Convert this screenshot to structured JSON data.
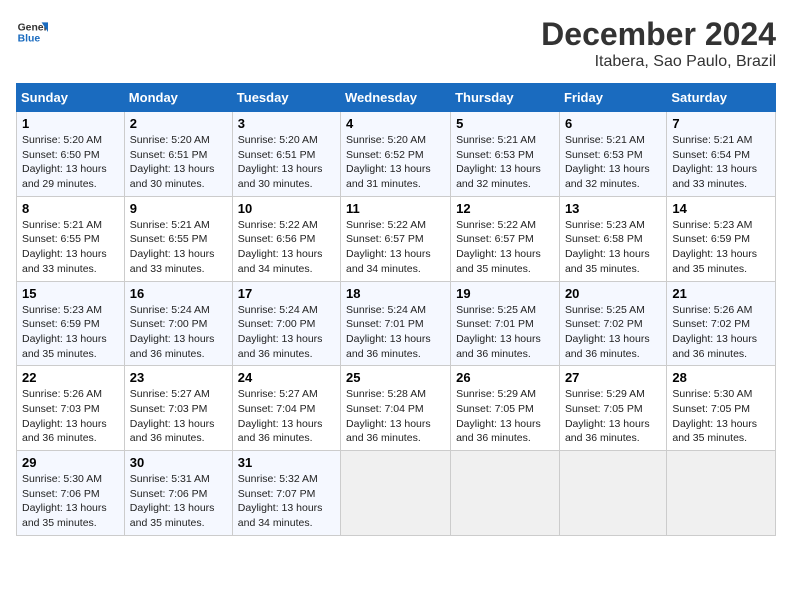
{
  "logo": {
    "text_general": "General",
    "text_blue": "Blue"
  },
  "title": "December 2024",
  "subtitle": "Itabera, Sao Paulo, Brazil",
  "days_of_week": [
    "Sunday",
    "Monday",
    "Tuesday",
    "Wednesday",
    "Thursday",
    "Friday",
    "Saturday"
  ],
  "weeks": [
    [
      {
        "day": "1",
        "info": "Sunrise: 5:20 AM\nSunset: 6:50 PM\nDaylight: 13 hours\nand 29 minutes."
      },
      {
        "day": "2",
        "info": "Sunrise: 5:20 AM\nSunset: 6:51 PM\nDaylight: 13 hours\nand 30 minutes."
      },
      {
        "day": "3",
        "info": "Sunrise: 5:20 AM\nSunset: 6:51 PM\nDaylight: 13 hours\nand 30 minutes."
      },
      {
        "day": "4",
        "info": "Sunrise: 5:20 AM\nSunset: 6:52 PM\nDaylight: 13 hours\nand 31 minutes."
      },
      {
        "day": "5",
        "info": "Sunrise: 5:21 AM\nSunset: 6:53 PM\nDaylight: 13 hours\nand 32 minutes."
      },
      {
        "day": "6",
        "info": "Sunrise: 5:21 AM\nSunset: 6:53 PM\nDaylight: 13 hours\nand 32 minutes."
      },
      {
        "day": "7",
        "info": "Sunrise: 5:21 AM\nSunset: 6:54 PM\nDaylight: 13 hours\nand 33 minutes."
      }
    ],
    [
      {
        "day": "8",
        "info": "Sunrise: 5:21 AM\nSunset: 6:55 PM\nDaylight: 13 hours\nand 33 minutes."
      },
      {
        "day": "9",
        "info": "Sunrise: 5:21 AM\nSunset: 6:55 PM\nDaylight: 13 hours\nand 33 minutes."
      },
      {
        "day": "10",
        "info": "Sunrise: 5:22 AM\nSunset: 6:56 PM\nDaylight: 13 hours\nand 34 minutes."
      },
      {
        "day": "11",
        "info": "Sunrise: 5:22 AM\nSunset: 6:57 PM\nDaylight: 13 hours\nand 34 minutes."
      },
      {
        "day": "12",
        "info": "Sunrise: 5:22 AM\nSunset: 6:57 PM\nDaylight: 13 hours\nand 35 minutes."
      },
      {
        "day": "13",
        "info": "Sunrise: 5:23 AM\nSunset: 6:58 PM\nDaylight: 13 hours\nand 35 minutes."
      },
      {
        "day": "14",
        "info": "Sunrise: 5:23 AM\nSunset: 6:59 PM\nDaylight: 13 hours\nand 35 minutes."
      }
    ],
    [
      {
        "day": "15",
        "info": "Sunrise: 5:23 AM\nSunset: 6:59 PM\nDaylight: 13 hours\nand 35 minutes."
      },
      {
        "day": "16",
        "info": "Sunrise: 5:24 AM\nSunset: 7:00 PM\nDaylight: 13 hours\nand 36 minutes."
      },
      {
        "day": "17",
        "info": "Sunrise: 5:24 AM\nSunset: 7:00 PM\nDaylight: 13 hours\nand 36 minutes."
      },
      {
        "day": "18",
        "info": "Sunrise: 5:24 AM\nSunset: 7:01 PM\nDaylight: 13 hours\nand 36 minutes."
      },
      {
        "day": "19",
        "info": "Sunrise: 5:25 AM\nSunset: 7:01 PM\nDaylight: 13 hours\nand 36 minutes."
      },
      {
        "day": "20",
        "info": "Sunrise: 5:25 AM\nSunset: 7:02 PM\nDaylight: 13 hours\nand 36 minutes."
      },
      {
        "day": "21",
        "info": "Sunrise: 5:26 AM\nSunset: 7:02 PM\nDaylight: 13 hours\nand 36 minutes."
      }
    ],
    [
      {
        "day": "22",
        "info": "Sunrise: 5:26 AM\nSunset: 7:03 PM\nDaylight: 13 hours\nand 36 minutes."
      },
      {
        "day": "23",
        "info": "Sunrise: 5:27 AM\nSunset: 7:03 PM\nDaylight: 13 hours\nand 36 minutes."
      },
      {
        "day": "24",
        "info": "Sunrise: 5:27 AM\nSunset: 7:04 PM\nDaylight: 13 hours\nand 36 minutes."
      },
      {
        "day": "25",
        "info": "Sunrise: 5:28 AM\nSunset: 7:04 PM\nDaylight: 13 hours\nand 36 minutes."
      },
      {
        "day": "26",
        "info": "Sunrise: 5:29 AM\nSunset: 7:05 PM\nDaylight: 13 hours\nand 36 minutes."
      },
      {
        "day": "27",
        "info": "Sunrise: 5:29 AM\nSunset: 7:05 PM\nDaylight: 13 hours\nand 36 minutes."
      },
      {
        "day": "28",
        "info": "Sunrise: 5:30 AM\nSunset: 7:05 PM\nDaylight: 13 hours\nand 35 minutes."
      }
    ],
    [
      {
        "day": "29",
        "info": "Sunrise: 5:30 AM\nSunset: 7:06 PM\nDaylight: 13 hours\nand 35 minutes."
      },
      {
        "day": "30",
        "info": "Sunrise: 5:31 AM\nSunset: 7:06 PM\nDaylight: 13 hours\nand 35 minutes."
      },
      {
        "day": "31",
        "info": "Sunrise: 5:32 AM\nSunset: 7:07 PM\nDaylight: 13 hours\nand 34 minutes."
      },
      {
        "day": "",
        "info": ""
      },
      {
        "day": "",
        "info": ""
      },
      {
        "day": "",
        "info": ""
      },
      {
        "day": "",
        "info": ""
      }
    ]
  ]
}
